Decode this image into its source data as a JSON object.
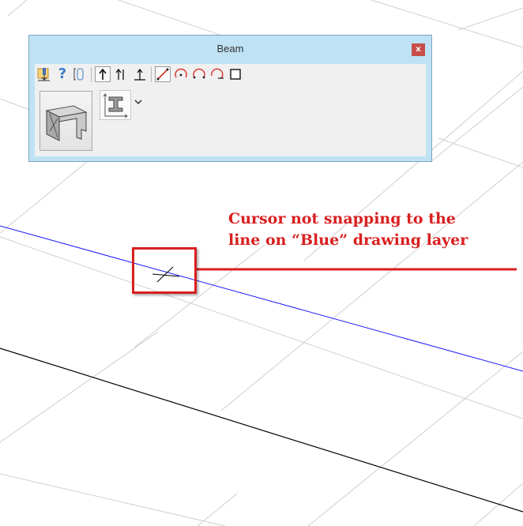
{
  "window": {
    "title": "Beam",
    "close_label": "x"
  },
  "toolbar": {
    "buttons": [
      {
        "name": "pick-tool-icon",
        "icon": "pencil-down"
      },
      {
        "name": "help-icon",
        "icon": "question",
        "glyph": "?"
      },
      {
        "name": "link-icon",
        "icon": "link"
      },
      {
        "name": "single-direction-icon",
        "icon": "up-arrow"
      },
      {
        "name": "dual-direction-icon",
        "icon": "dual-arrow"
      },
      {
        "name": "perpendicular-icon",
        "icon": "perpendicular"
      },
      {
        "name": "line-mode-icon",
        "icon": "line"
      },
      {
        "name": "arc-center-icon",
        "icon": "arc-center"
      },
      {
        "name": "arc-3pt-icon",
        "icon": "arc"
      },
      {
        "name": "arc-tangent-icon",
        "icon": "arc-tangent"
      },
      {
        "name": "rectangle-icon",
        "icon": "rectangle"
      }
    ]
  },
  "panel": {
    "preview_icon": "beam-3d",
    "profile_icon": "i-beam",
    "dropdown_icon": "chevron-down"
  },
  "annotation": {
    "line1": "Cursor not snapping to the",
    "line2": "line on “Blue” drawing layer",
    "color": "#d91f1f"
  },
  "colors": {
    "blue_layer": "#1a1aff",
    "black_layer": "#000000",
    "grid": "#c8c8c8",
    "highlight": "#d91f1f"
  }
}
